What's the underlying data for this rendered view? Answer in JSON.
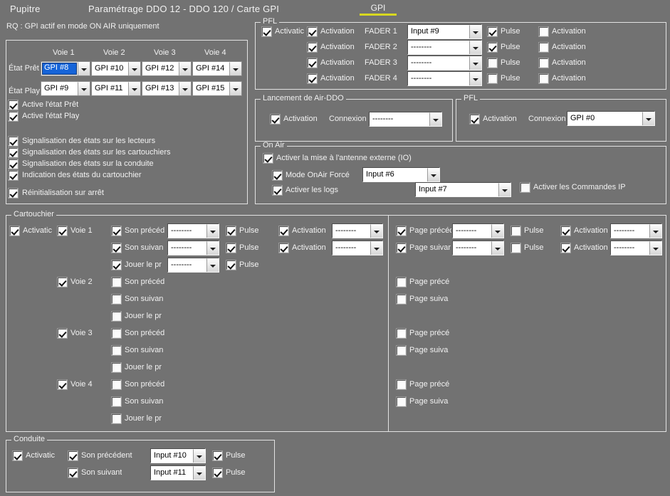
{
  "header": {
    "app_name": "Pupitre",
    "title": "Paramétrage DDO 12 - DDO 120 / Carte GPI",
    "tab_gpi": "GPI",
    "note": "RQ : GPI actif en mode ON AIR uniquement"
  },
  "etats": {
    "col_headers": [
      "Voie 1",
      "Voie 2",
      "Voie 3",
      "Voie 4"
    ],
    "row_pret_label": "État Prêt",
    "row_play_label": "État Play",
    "pret_values": [
      "GPI #8",
      "GPI #10",
      "GPI #12",
      "GPI #14"
    ],
    "play_values": [
      "GPI #9",
      "GPI #11",
      "GPI #13",
      "GPI #15"
    ],
    "checks": [
      {
        "label": "Active l'état Prêt",
        "checked": true
      },
      {
        "label": "Active l'état Play",
        "checked": true
      },
      {
        "label": "Signalisation des états sur les lecteurs",
        "checked": true
      },
      {
        "label": "Signalisation des états sur les cartouchiers",
        "checked": true
      },
      {
        "label": "Signalisation des états sur la conduite",
        "checked": true
      },
      {
        "label": "Indication des états du cartouchier",
        "checked": true
      },
      {
        "label": "Réinitialisation sur arrêt",
        "checked": true
      }
    ]
  },
  "pfl_faders": {
    "legend": "PFL",
    "master_label": "Activatic",
    "master_checked": true,
    "rows": [
      {
        "act_label": "Activation",
        "act_checked": true,
        "fader": "FADER 1",
        "value": "Input #9",
        "pulse_label": "Pulse",
        "pulse_checked": true,
        "act2_label": "Activation",
        "act2_checked": false
      },
      {
        "act_label": "Activation",
        "act_checked": true,
        "fader": "FADER 2",
        "value": "--------",
        "pulse_label": "Pulse",
        "pulse_checked": true,
        "act2_label": "Activation",
        "act2_checked": false
      },
      {
        "act_label": "Activation",
        "act_checked": true,
        "fader": "FADER 3",
        "value": "--------",
        "pulse_label": "Pulse",
        "pulse_checked": false,
        "act2_label": "Activation",
        "act2_checked": false
      },
      {
        "act_label": "Activation",
        "act_checked": true,
        "fader": "FADER 4",
        "value": "--------",
        "pulse_label": "Pulse",
        "pulse_checked": false,
        "act2_label": "Activation",
        "act2_checked": false
      }
    ]
  },
  "lancement": {
    "legend": "Lancement de Air-DDO",
    "act_label": "Activation",
    "act_checked": true,
    "connexion_label": "Connexion",
    "value": "--------"
  },
  "pfl_connexion": {
    "legend": "PFL",
    "act_label": "Activation",
    "act_checked": true,
    "connexion_label": "Connexion",
    "value": "GPI #0"
  },
  "onair": {
    "legend": "On Air",
    "main_label": "Activer la mise à l'antenne externe (IO)",
    "main_checked": true,
    "force_label": "Mode OnAir Forcé",
    "force_checked": true,
    "force_value": "Input #6",
    "logs_label": "Activer les logs",
    "logs_checked": true,
    "logs_value": "Input #7",
    "ip_label": "Activer les Commandes IP",
    "ip_checked": false
  },
  "cartouchier": {
    "legend": "Cartouchier",
    "master_label": "Activatic",
    "master_checked": true,
    "voies": [
      {
        "voie_label": "Voie 1",
        "voie_checked": true,
        "actions": [
          {
            "label": "Son précéd",
            "checked": true,
            "value": "--------",
            "pulse_label": "Pulse",
            "pulse_checked": true,
            "act_label": "Activation",
            "act_checked": true,
            "act_value": "--------"
          },
          {
            "label": "Son suivan",
            "checked": true,
            "value": "--------",
            "pulse_label": "Pulse",
            "pulse_checked": true,
            "act_label": "Activation",
            "act_checked": true,
            "act_value": "--------"
          },
          {
            "label": "Jouer le pr",
            "checked": true,
            "value": "--------",
            "pulse_label": "Pulse",
            "pulse_checked": true,
            "act_label": "",
            "act_checked": false,
            "act_value": ""
          }
        ],
        "pages": [
          {
            "label": "Page précéd",
            "checked": true,
            "value": "--------",
            "pulse_label": "Pulse",
            "pulse_checked": false,
            "act_label": "Activation",
            "act_checked": true,
            "act_value": "--------"
          },
          {
            "label": "Page suivar",
            "checked": true,
            "value": "--------",
            "pulse_label": "Pulse",
            "pulse_checked": false,
            "act_label": "Activation",
            "act_checked": true,
            "act_value": "--------"
          }
        ]
      },
      {
        "voie_label": "Voie 2",
        "voie_checked": true,
        "actions": [
          {
            "label": "Son précéd",
            "checked": false
          },
          {
            "label": "Son suivan",
            "checked": false
          },
          {
            "label": "Jouer le pr",
            "checked": false
          }
        ],
        "pages": [
          {
            "label": "Page précé",
            "checked": false
          },
          {
            "label": "Page suiva",
            "checked": false
          }
        ]
      },
      {
        "voie_label": "Voie 3",
        "voie_checked": true,
        "actions": [
          {
            "label": "Son précéd",
            "checked": false
          },
          {
            "label": "Son suivan",
            "checked": false
          },
          {
            "label": "Jouer le pr",
            "checked": false
          }
        ],
        "pages": [
          {
            "label": "Page précé",
            "checked": false
          },
          {
            "label": "Page suiva",
            "checked": false
          }
        ]
      },
      {
        "voie_label": "Voie 4",
        "voie_checked": true,
        "actions": [
          {
            "label": "Son précéd",
            "checked": false
          },
          {
            "label": "Son suivan",
            "checked": false
          },
          {
            "label": "Jouer le pr",
            "checked": false
          }
        ],
        "pages": [
          {
            "label": "Page précé",
            "checked": false
          },
          {
            "label": "Page suiva",
            "checked": false
          }
        ]
      }
    ]
  },
  "conduite": {
    "legend": "Conduite",
    "master_label": "Activatic",
    "master_checked": true,
    "rows": [
      {
        "label": "Son précédent",
        "checked": true,
        "value": "Input #10",
        "pulse_label": "Pulse",
        "pulse_checked": true
      },
      {
        "label": "Son suivant",
        "checked": true,
        "value": "Input #11",
        "pulse_label": "Pulse",
        "pulse_checked": true
      }
    ]
  },
  "colors": {
    "background": "#727272",
    "border": "#e2e2e2",
    "tab_accent": "#d8d820",
    "selection": "#1664d8",
    "text": "#f2f2f2"
  }
}
